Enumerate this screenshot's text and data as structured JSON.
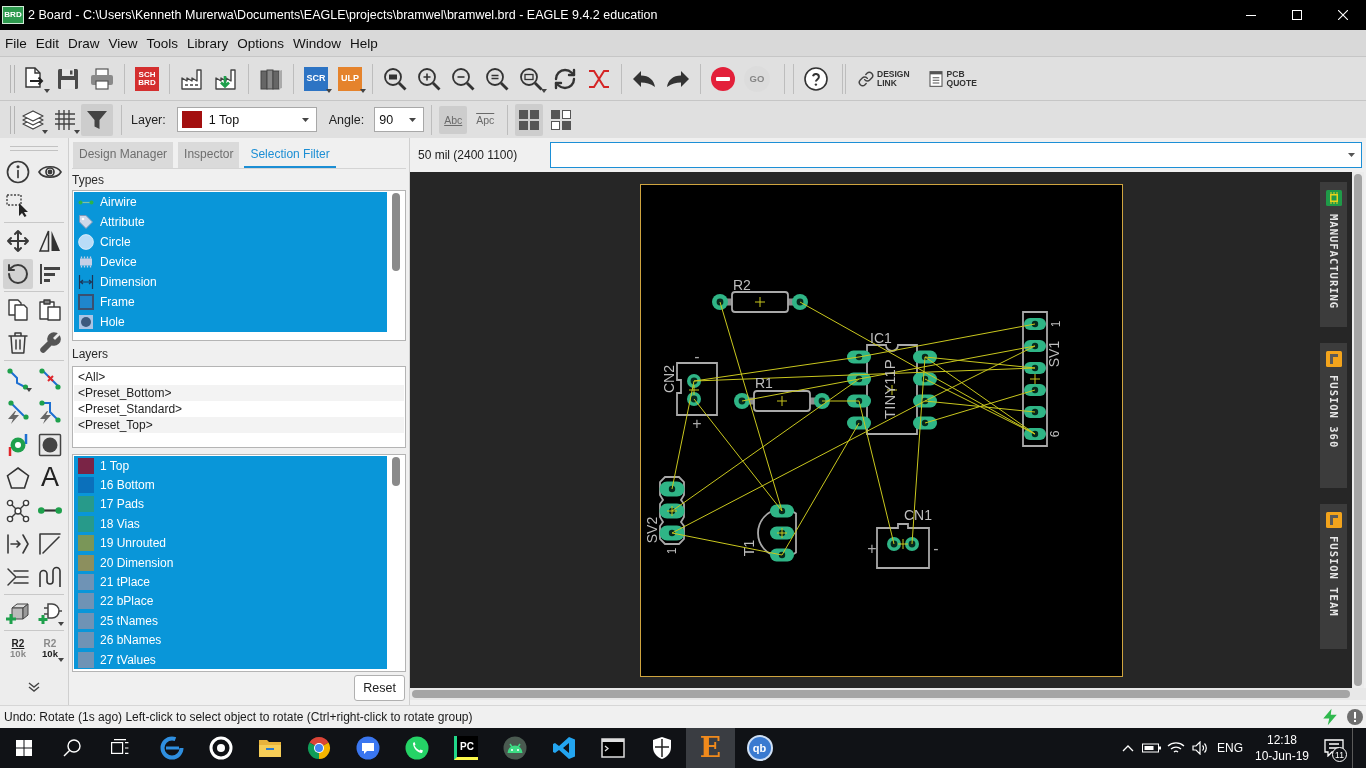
{
  "window": {
    "icon_label": "BRD",
    "title": "2 Board - C:\\Users\\Kenneth Murerwa\\Documents\\EAGLE\\projects\\bramwel\\bramwel.brd - EAGLE 9.4.2 education"
  },
  "menu": [
    "File",
    "Edit",
    "Draw",
    "View",
    "Tools",
    "Library",
    "Options",
    "Window",
    "Help"
  ],
  "main_toolbar": {
    "switch_label": "SCH BRD",
    "script_label": "SCR",
    "ulp_label": "ULP",
    "go": {
      "label": "GO",
      "disabled": true
    },
    "design_link": "DESIGN LINK",
    "pcb_quote": "PCB QUOTE"
  },
  "options_toolbar": {
    "filter_on": true,
    "layer": {
      "label": "Layer:",
      "value": "1 Top"
    },
    "angle": {
      "label": "Angle:",
      "value": "90"
    },
    "text_toggles": [
      {
        "kind": "upright",
        "label": "Abc",
        "selected": true
      },
      {
        "kind": "mirrored",
        "label": "Apc",
        "selected": false
      }
    ],
    "layout_toggles": [
      {
        "selected": true
      },
      {
        "selected": false
      }
    ]
  },
  "tools": [
    {
      "kind": "icon",
      "selected": false
    },
    {
      "kind": "icon",
      "selected": false
    },
    {
      "kind": "icon",
      "selected": false
    },
    {
      "kind": "icon",
      "selected": false
    },
    {
      "kind": "icon",
      "selected": false
    },
    {
      "kind": "icon",
      "selected": true
    },
    {
      "kind": "icon",
      "selected": false
    },
    {
      "kind": "icon",
      "selected": false
    },
    {
      "kind": "icon",
      "selected": false
    },
    {
      "kind": "icon",
      "selected": false
    },
    {
      "kind": "icon",
      "selected": false
    },
    {
      "kind": "icon",
      "selected": false
    },
    {
      "kind": "icon",
      "selected": false
    },
    {
      "kind": "icon",
      "selected": false
    },
    {
      "kind": "icon",
      "selected": false
    },
    {
      "kind": "icon",
      "selected": false
    },
    {
      "kind": "icon",
      "selected": false
    },
    {
      "kind": "icon",
      "selected": false
    },
    {
      "kind": "glyph",
      "label": "A",
      "selected": false
    },
    {
      "kind": "icon",
      "selected": false
    },
    {
      "kind": "icon",
      "selected": false
    },
    {
      "kind": "icon",
      "selected": false
    },
    {
      "kind": "icon",
      "selected": false
    },
    {
      "kind": "icon",
      "selected": false
    },
    {
      "kind": "icon",
      "selected": false
    },
    {
      "kind": "icon",
      "selected": false
    },
    {
      "kind": "icon",
      "selected": false
    },
    {
      "kind": "name",
      "name": "R2",
      "value": "10k",
      "selected": false
    },
    {
      "kind": "value",
      "name": "R2",
      "value": "10k",
      "selected": false
    }
  ],
  "panel": {
    "tabs": [
      {
        "label": "Design Manager",
        "selected": false
      },
      {
        "label": "Inspector",
        "selected": false
      },
      {
        "label": "Selection Filter",
        "selected": true
      }
    ],
    "types": {
      "heading": "Types",
      "items": [
        {
          "label": "Airwire",
          "selected": true
        },
        {
          "label": "Attribute",
          "selected": true
        },
        {
          "label": "Circle",
          "selected": true
        },
        {
          "label": "Device",
          "selected": true
        },
        {
          "label": "Dimension",
          "selected": true
        },
        {
          "label": "Frame",
          "selected": true
        },
        {
          "label": "Hole",
          "selected": true
        }
      ]
    },
    "layers": {
      "heading": "Layers",
      "presets": [
        {
          "label": "<All>",
          "selected": false
        },
        {
          "label": "<Preset_Bottom>",
          "selected": false
        },
        {
          "label": "<Preset_Standard>",
          "selected": false
        },
        {
          "label": "<Preset_Top>",
          "selected": false
        }
      ],
      "items": [
        {
          "label": "1 Top",
          "color": "#7a2446",
          "selected": true
        },
        {
          "label": "16 Bottom",
          "color": "#0b70bb",
          "selected": true
        },
        {
          "label": "17 Pads",
          "color": "#279a8a",
          "selected": true
        },
        {
          "label": "18 Vias",
          "color": "#279a8a",
          "selected": true
        },
        {
          "label": "19 Unrouted",
          "color": "#7a9658",
          "selected": true
        },
        {
          "label": "20 Dimension",
          "color": "#8c8f5e",
          "selected": true
        },
        {
          "label": "21 tPlace",
          "color": "#6f93b5",
          "selected": true
        },
        {
          "label": "22 bPlace",
          "color": "#6f93b5",
          "selected": true
        },
        {
          "label": "25 tNames",
          "color": "#6f93b5",
          "selected": true
        },
        {
          "label": "26 bNames",
          "color": "#6f93b5",
          "selected": true
        },
        {
          "label": "27 tValues",
          "color": "#6f93b5",
          "selected": true
        }
      ]
    },
    "reset": "Reset"
  },
  "canvas": {
    "coordinates": "50 mil (2400 1100)",
    "parts": [
      {
        "kind": "resistor",
        "name": "R2"
      },
      {
        "kind": "resistor",
        "name": "R1"
      },
      {
        "kind": "dip",
        "name": "IC1",
        "value": "TINY11P"
      },
      {
        "kind": "connector",
        "name": "CN2",
        "marks": [
          "-",
          "+"
        ]
      },
      {
        "kind": "header",
        "name": "SV1",
        "pins": [
          "1",
          "6"
        ]
      },
      {
        "kind": "header",
        "name": "SV2",
        "pins": [
          "1"
        ]
      },
      {
        "kind": "transistor",
        "name": "T1"
      },
      {
        "kind": "connector",
        "name": "CN1",
        "marks": [
          "+",
          "-"
        ]
      }
    ],
    "side_tabs": [
      {
        "kind": "manufacturing",
        "label": "MANUFACTURING"
      },
      {
        "kind": "fusion",
        "label": "FUSION 360"
      },
      {
        "kind": "fusion",
        "label": "FUSION TEAM"
      }
    ]
  },
  "status_bar": {
    "message": "Undo: Rotate (1s ago) Left-click to select object to rotate (Ctrl+right-click to rotate group)"
  },
  "taskbar": {
    "apps": [
      {
        "kind": "icon",
        "active": false
      },
      {
        "kind": "icon",
        "active": false
      },
      {
        "kind": "icon",
        "active": false
      },
      {
        "kind": "icon",
        "active": false
      },
      {
        "kind": "icon",
        "active": false
      },
      {
        "kind": "icon",
        "active": false
      },
      {
        "kind": "tile",
        "label": "PC",
        "active": false
      },
      {
        "kind": "icon",
        "active": false
      },
      {
        "kind": "icon",
        "active": false
      },
      {
        "kind": "icon",
        "active": false
      },
      {
        "kind": "icon",
        "active": false
      },
      {
        "kind": "letter",
        "label": "E",
        "active": true
      },
      {
        "kind": "disc",
        "label": "qb",
        "active": false
      }
    ],
    "language": "ENG",
    "time": "12:18",
    "date": "10-Jun-19",
    "notifications": "11"
  }
}
